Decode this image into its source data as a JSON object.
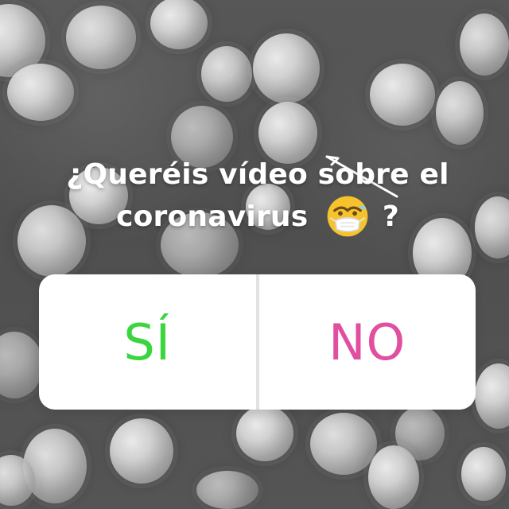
{
  "colors": {
    "yes": "#3ad53f",
    "no": "#e14fa0",
    "question": "#ffffff"
  },
  "prompt": {
    "line1": "¿Queréis vídeo sobre el",
    "line2_prefix": "coronavirus",
    "emoji": "face-with-medical-mask",
    "line2_suffix": "?"
  },
  "poll": {
    "yes_label": "SÍ",
    "no_label": "NO"
  }
}
